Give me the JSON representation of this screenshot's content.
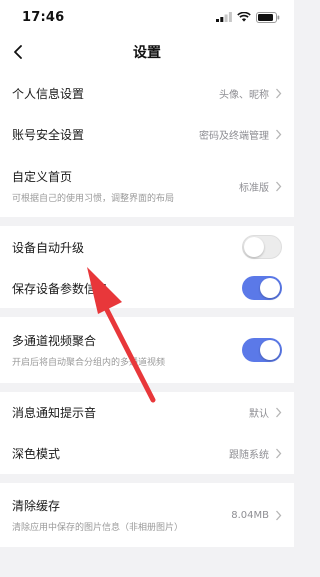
{
  "status_bar": {
    "time": "17:46"
  },
  "nav": {
    "title": "设置"
  },
  "groups": [
    {
      "rows": [
        {
          "title": "个人信息设置",
          "value": "头像、昵称"
        },
        {
          "title": "账号安全设置",
          "value": "密码及终端管理"
        },
        {
          "title": "自定义首页",
          "subtitle": "可根据自己的使用习惯，调整界面的布局",
          "value": "标准版"
        }
      ]
    },
    {
      "rows": [
        {
          "title": "设备自动升级",
          "toggle": false
        },
        {
          "title": "保存设备参数信息",
          "toggle": true
        }
      ]
    },
    {
      "rows": [
        {
          "title": "多通道视频聚合",
          "subtitle": "开启后将自动聚合分组内的多通道视频",
          "toggle": true
        }
      ]
    },
    {
      "rows": [
        {
          "title": "消息通知提示音",
          "value": "默认"
        },
        {
          "title": "深色模式",
          "value": "跟随系统"
        }
      ]
    },
    {
      "rows": [
        {
          "title": "清除缓存",
          "subtitle": "清除应用中保存的图片信息（非相册图片）",
          "value": "8.04MB"
        }
      ]
    }
  ],
  "colors": {
    "accent": "#5b79e8",
    "annotation_arrow": "#e8373a"
  },
  "icons": {
    "back": "chevron-left-icon",
    "row_chevron": "chevron-right-icon"
  }
}
